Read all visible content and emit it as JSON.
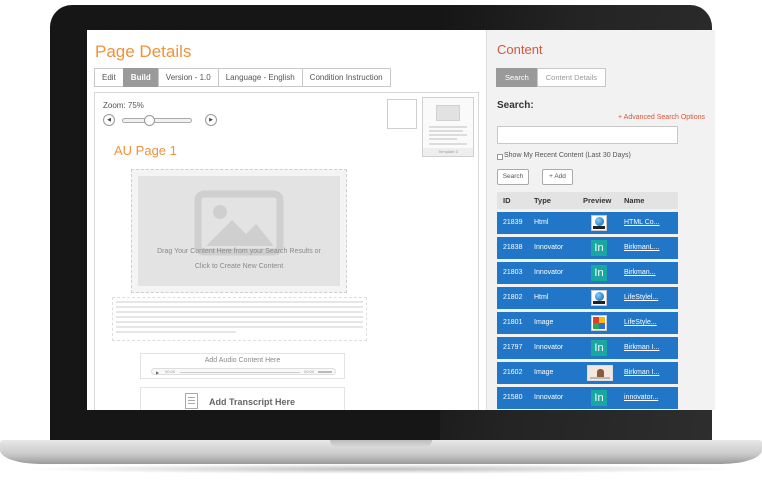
{
  "left": {
    "title": "Page Details",
    "tabs": [
      "Edit",
      "Build",
      "Version - 1.0",
      "Language - English",
      "Condition Instruction"
    ],
    "zoom_label": "Zoom: 75%",
    "zoom_level_percent": 75,
    "template_label": "Template 3",
    "page_heading": "AU Page 1",
    "drop_text_1": "Drag Your Content Here from your Search Results or",
    "drop_text_2": "Click to Create New Content",
    "audio_label": "Add Audio Content Here",
    "audio_time_start": "00:00",
    "audio_time_end": "00:00",
    "transcript_label": "Add Transcript Here"
  },
  "right": {
    "title": "Content",
    "tabs": [
      "Search",
      "Content Details"
    ],
    "search_label": "Search:",
    "advanced_link": "+ Advanced Search Options",
    "search_value": "",
    "recent_checkbox_label": "Show My Recent Content (Last 30 Days)",
    "search_button": "Search",
    "add_button": "+ Add",
    "columns": [
      "ID",
      "Type",
      "Preview",
      "Name"
    ],
    "rows": [
      {
        "id": "21839",
        "type": "Html",
        "preview": "html",
        "name": "HTML Co..."
      },
      {
        "id": "21838",
        "type": "Innovator",
        "preview": "innovator",
        "name": "BirkmanL..."
      },
      {
        "id": "21803",
        "type": "Innovator",
        "preview": "innovator",
        "name": "Birkman..."
      },
      {
        "id": "21802",
        "type": "Html",
        "preview": "html",
        "name": "LifeStylel..."
      },
      {
        "id": "21801",
        "type": "Image",
        "preview": "image",
        "name": "LifeStyle..."
      },
      {
        "id": "21797",
        "type": "Innovator",
        "preview": "innovator",
        "name": "Birkman I..."
      },
      {
        "id": "21602",
        "type": "Image",
        "preview": "photo",
        "name": "Birkman I..."
      },
      {
        "id": "21580",
        "type": "Innovator",
        "preview": "innovator",
        "name": "innovator..."
      }
    ]
  },
  "colors": {
    "accent_orange": "#f0923a",
    "accent_red": "#d9563a",
    "row_blue": "#2176c8",
    "innovator_teal": "#18a8a0"
  }
}
